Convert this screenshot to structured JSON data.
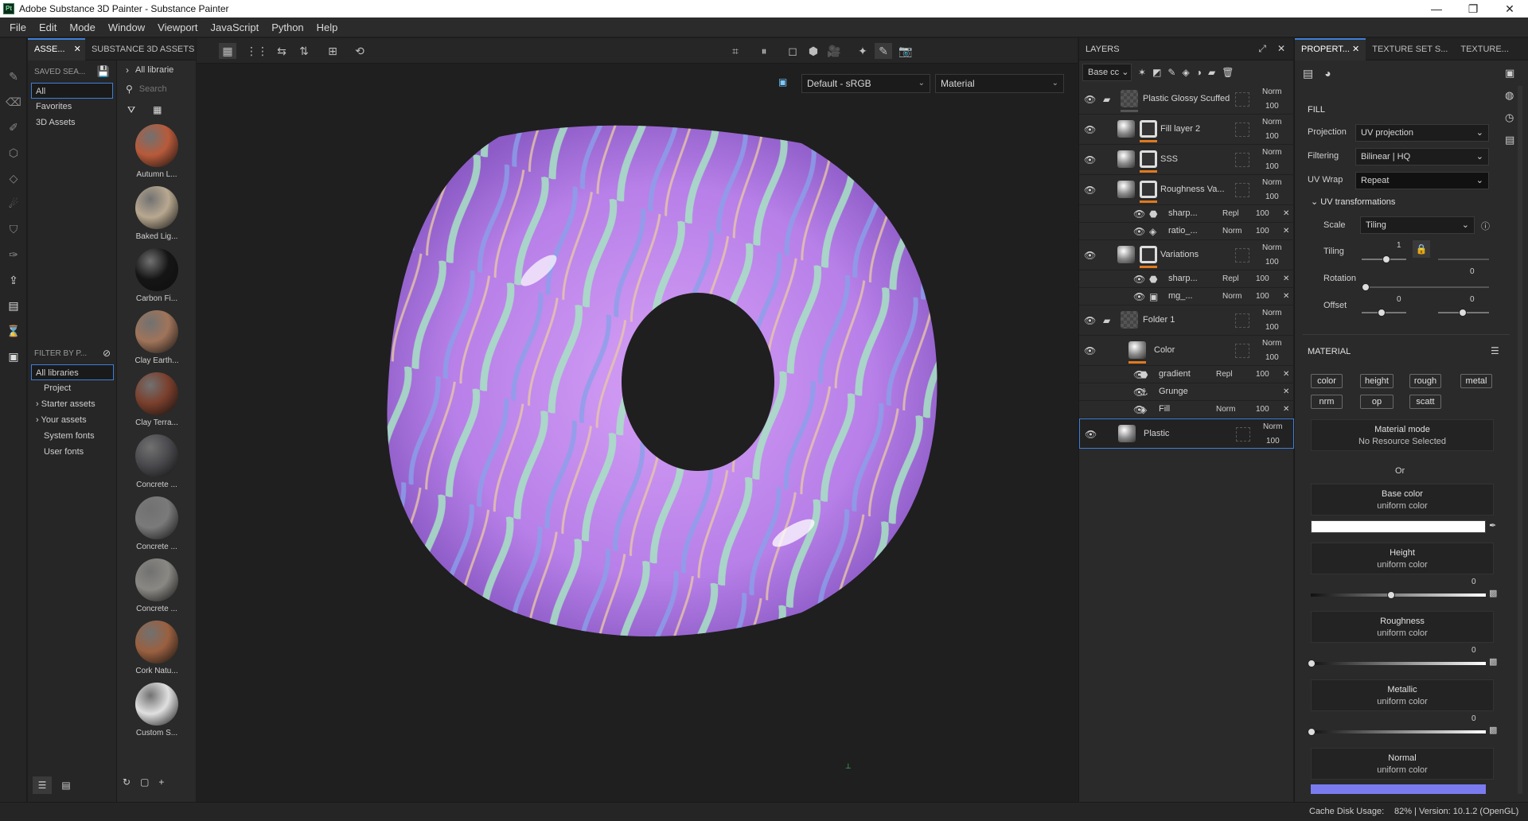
{
  "window": {
    "title": "Adobe Substance 3D Painter - Substance Painter",
    "logo": "Pt"
  },
  "menu": [
    "File",
    "Edit",
    "Mode",
    "Window",
    "Viewport",
    "JavaScript",
    "Python",
    "Help"
  ],
  "assets": {
    "tabs": [
      "ASSE...",
      "SUBSTANCE 3D ASSETS"
    ],
    "saved_searches_label": "SAVED SEA...",
    "breadcrumb": "All librarie",
    "search_placeholder": "Search",
    "saved_items": [
      "All",
      "Favorites",
      "3D Assets"
    ],
    "filter_label": "FILTER BY P...",
    "filter_items": [
      "All libraries",
      "Project",
      "Starter assets",
      "Your assets",
      "System fonts",
      "User fonts"
    ],
    "thumbnails": [
      {
        "label": "Autumn L...",
        "color": "#b85a3a"
      },
      {
        "label": "Baked Lig...",
        "color": "#b8a890"
      },
      {
        "label": "Carbon Fi...",
        "color": "#151515"
      },
      {
        "label": "Clay Earth...",
        "color": "#a0745a"
      },
      {
        "label": "Clay Terra...",
        "color": "#7a3f2c"
      },
      {
        "label": "Concrete ...",
        "color": "#4a4a4e"
      },
      {
        "label": "Concrete ...",
        "color": "#7a7a7a"
      },
      {
        "label": "Concrete ...",
        "color": "#8a8883"
      },
      {
        "label": "Cork Natu...",
        "color": "#9a6040"
      },
      {
        "label": "Custom S...",
        "color": "#e0e0e0"
      }
    ]
  },
  "viewport": {
    "colorspace": "Default - sRGB",
    "channel": "Material"
  },
  "layers": {
    "title": "LAYERS",
    "channel_select": "Base cc",
    "items": [
      {
        "name": "Plastic Glossy Scuffed",
        "blend": "Norm",
        "opacity": "100"
      },
      {
        "name": "Fill layer 2",
        "blend": "Norm",
        "opacity": "100"
      },
      {
        "name": "SSS",
        "blend": "Norm",
        "opacity": "100"
      },
      {
        "name": "Roughness Va...",
        "blend": "Norm",
        "opacity": "100"
      },
      {
        "name": "sharp...",
        "blend": "Repl",
        "opacity": "100"
      },
      {
        "name": "ratio_...",
        "blend": "Norm",
        "opacity": "100"
      },
      {
        "name": "Variations",
        "blend": "Norm",
        "opacity": "100"
      },
      {
        "name": "sharp...",
        "blend": "Repl",
        "opacity": "100"
      },
      {
        "name": "mg_...",
        "blend": "Norm",
        "opacity": "100"
      },
      {
        "name": "Folder 1",
        "blend": "Norm",
        "opacity": "100"
      },
      {
        "name": "Color",
        "blend": "Norm",
        "opacity": "100"
      },
      {
        "name": "gradient",
        "blend": "Repl",
        "opacity": "100"
      },
      {
        "name": "Grunge",
        "blend": "",
        "opacity": ""
      },
      {
        "name": "Fill",
        "blend": "Norm",
        "opacity": "100"
      },
      {
        "name": "Plastic",
        "blend": "Norm",
        "opacity": "100"
      }
    ]
  },
  "properties": {
    "tabs": [
      "PROPERT...",
      "TEXTURE SET S...",
      "TEXTURE..."
    ],
    "fill_heading": "FILL",
    "projection_label": "Projection",
    "projection_value": "UV projection",
    "filtering_label": "Filtering",
    "filtering_value": "Bilinear | HQ",
    "uvwrap_label": "UV Wrap",
    "uvwrap_value": "Repeat",
    "uvtrans_label": "UV transformations",
    "scale_label": "Scale",
    "scale_value": "Tiling",
    "tiling_label": "Tiling",
    "tiling_value": "1",
    "rotation_label": "Rotation",
    "rotation_value": "0",
    "offset_label": "Offset",
    "offset_x": "0",
    "offset_y": "0",
    "tiling_side_value": "0",
    "material_heading": "MATERIAL",
    "chips": [
      "color",
      "height",
      "rough",
      "metal",
      "nrm",
      "op",
      "scatt"
    ],
    "material_mode_title": "Material mode",
    "material_mode_sub": "No Resource Selected",
    "or_text": "Or",
    "channels": [
      {
        "name": "Base color",
        "sub": "uniform color"
      },
      {
        "name": "Height",
        "sub": "uniform color",
        "value": "0"
      },
      {
        "name": "Roughness",
        "sub": "uniform color",
        "value": "0"
      },
      {
        "name": "Metallic",
        "sub": "uniform color",
        "value": "0"
      },
      {
        "name": "Normal",
        "sub": "uniform color"
      }
    ],
    "normal_color": "#7b7bf0"
  },
  "status": {
    "cache_label": "Cache Disk Usage:",
    "cache_value": "82% | Version: 10.1.2 (OpenGL)"
  }
}
